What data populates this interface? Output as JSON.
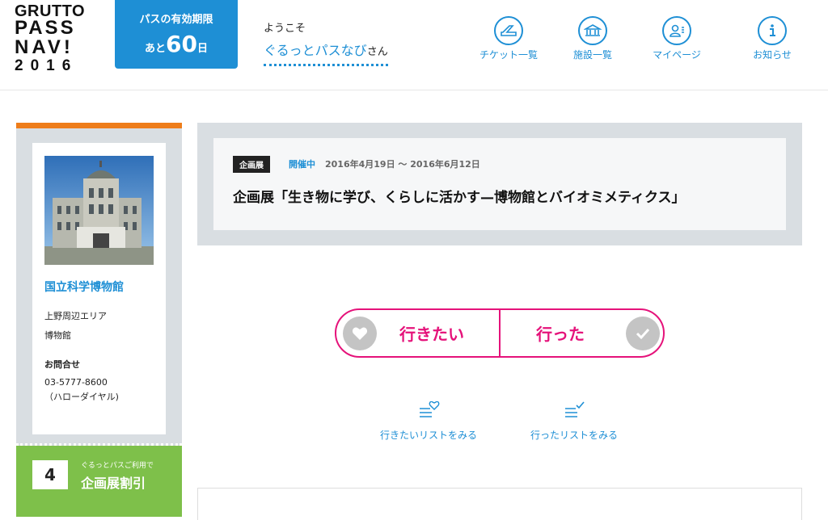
{
  "logo": {
    "l1": "GRUTTO",
    "l2": "PASS",
    "l3": "NAV!",
    "l4": "2016"
  },
  "pass": {
    "title": "パスの有効期限",
    "prefix": "あと",
    "days": "60",
    "unit": "日"
  },
  "welcome": {
    "greet": "ようこそ",
    "user": "ぐるっとパスなび",
    "suffix": "さん"
  },
  "nav": [
    {
      "label": "チケット一覧",
      "icon": "ticket-icon"
    },
    {
      "label": "施設一覧",
      "icon": "museum-icon"
    },
    {
      "label": "マイページ",
      "icon": "user-icon"
    },
    {
      "label": "お知らせ",
      "icon": "info-icon"
    }
  ],
  "facility": {
    "name": "国立科学博物館",
    "area": "上野周辺エリア",
    "category": "博物館",
    "contact_label": "お問合せ",
    "tel": "03-5777-8600",
    "tel_note": "（ハローダイヤル)"
  },
  "discount": {
    "num": "4",
    "small": "ぐるっとパスご利用で",
    "big": "企画展割引"
  },
  "event": {
    "tag": "企画展",
    "status": "開催中",
    "dates": "2016年4月19日 ～ 2016年6月12日",
    "title": "企画展「生き物に学び、くらしに活かす—博物館とバイオミメティクス」"
  },
  "actions": {
    "want": "行きたい",
    "went": "行った"
  },
  "lists": {
    "want": "行きたいリストをみる",
    "went": "行ったリストをみる"
  },
  "colors": {
    "accent": "#1e8fd5",
    "pink": "#e5127a",
    "orange": "#ee7d1a",
    "green": "#7ec04a"
  }
}
